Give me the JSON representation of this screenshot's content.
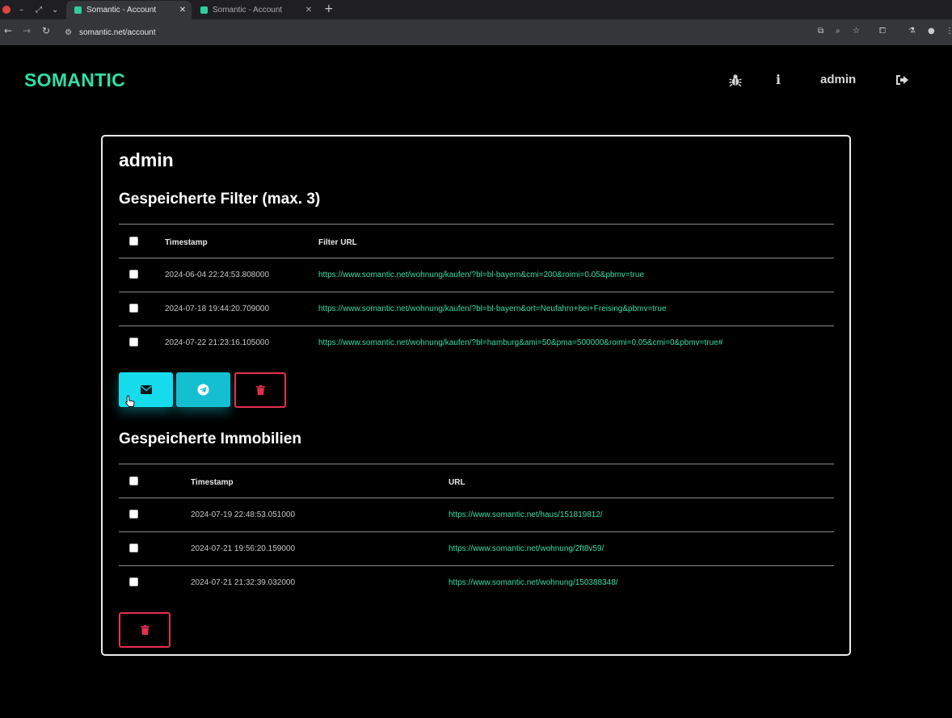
{
  "browser": {
    "tabs": [
      {
        "title": "Somantic - Account",
        "active": true
      },
      {
        "title": "Somantic - Account",
        "active": false
      }
    ],
    "url": "somantic.net/account"
  },
  "colors": {
    "brand": "#2fe0a8",
    "link": "#33dfa6",
    "accent": "#17dcee",
    "danger": "#e4304f"
  },
  "header": {
    "brand": "SOMANTIC",
    "icons": [
      "bug-icon",
      "info-icon",
      "logout-icon"
    ],
    "info_glyph": "i",
    "username": "admin"
  },
  "account": {
    "title": "admin",
    "filters": {
      "heading": "Gespeicherte Filter (max. 3)",
      "columns": {
        "timestamp": "Timestamp",
        "url": "Filter URL"
      },
      "rows": [
        {
          "timestamp": "2024-06-04 22:24:53.808000",
          "url": "https://www.somantic.net/wohnung/kaufen/?bl=bl-bayern&cmi=200&roimi=0.05&pbmv=true"
        },
        {
          "timestamp": "2024-07-18 19:44:20.709000",
          "url": "https://www.somantic.net/wohnung/kaufen/?bl=bl-bayern&ort=Neufahrn+bei+Freising&pbmv=true"
        },
        {
          "timestamp": "2024-07-22 21:23:16.105000",
          "url": "https://www.somantic.net/wohnung/kaufen/?bl=hamburg&ami=50&pma=500000&roimi=0.05&cmi=0&pbmv=true#"
        }
      ],
      "actions": [
        "mail-icon",
        "telegram-icon",
        "trash-icon"
      ]
    },
    "properties": {
      "heading": "Gespeicherte Immobilien",
      "columns": {
        "timestamp": "Timestamp",
        "url": "URL"
      },
      "rows": [
        {
          "timestamp": "2024-07-19 22:48:53.051000",
          "url": "https://www.somantic.net/haus/151819812/"
        },
        {
          "timestamp": "2024-07-21 19:56:20.159000",
          "url": "https://www.somantic.net/wohnung/2ft8v59/"
        },
        {
          "timestamp": "2024-07-21 21:32:39.032000",
          "url": "https://www.somantic.net/wohnung/150388348/"
        }
      ],
      "actions": [
        "trash-icon"
      ]
    }
  }
}
